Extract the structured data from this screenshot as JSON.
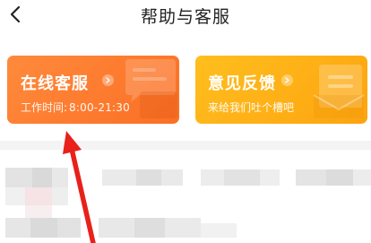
{
  "header": {
    "title": "帮助与客服",
    "back_icon": "chevron-left-icon"
  },
  "cards": {
    "service": {
      "title": "在线客服",
      "hours_label": "工作时间:",
      "hours_value": "8:00-21:30",
      "color": "#fb7a2e",
      "icon": "chat-bubble-icon"
    },
    "feedback": {
      "title": "意见反馈",
      "subtitle": "来给我们吐个槽吧",
      "color": "#fdb014",
      "icon": "document-envelope-icon"
    }
  },
  "annotation": {
    "color": "#e8211b",
    "icon": "red-arrow-icon"
  }
}
